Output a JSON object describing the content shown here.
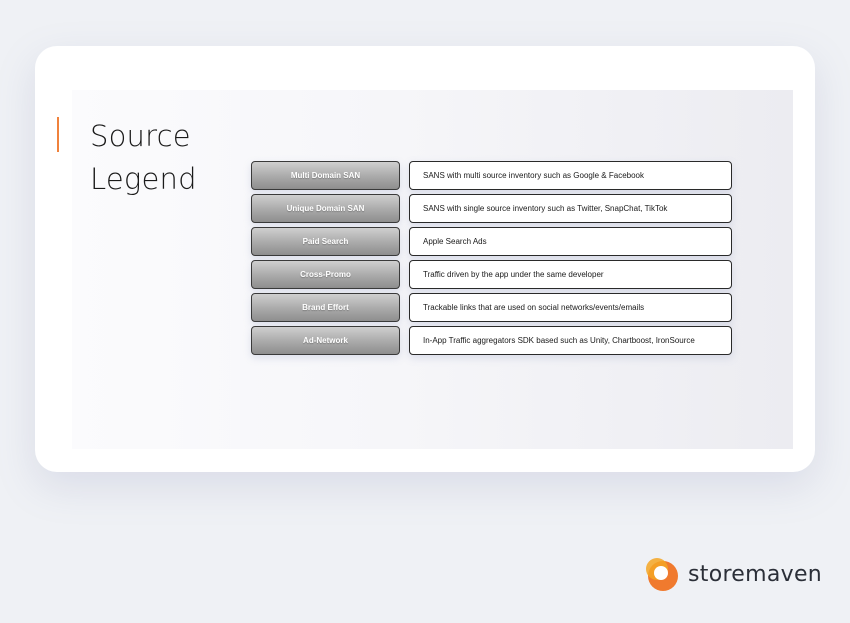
{
  "title": {
    "line1": "Source",
    "line2": "Legend"
  },
  "legend": [
    {
      "source": "Multi Domain SAN",
      "description": "SANS with multi source inventory such as Google & Facebook"
    },
    {
      "source": "Unique Domain SAN",
      "description": "SANS with single source inventory such as Twitter, SnapChat, TikTok"
    },
    {
      "source": "Paid Search",
      "description": "Apple Search Ads"
    },
    {
      "source": "Cross-Promo",
      "description": "Traffic driven by the app under the same developer"
    },
    {
      "source": "Brand Effort",
      "description": "Trackable links that are used on social networks/events/emails"
    },
    {
      "source": "Ad-Network",
      "description": "In-App Traffic aggregators SDK based such as Unity, Chartboost, IronSource"
    }
  ],
  "brand": {
    "name": "storemaven",
    "icon": "storemaven-logo-icon"
  },
  "colors": {
    "accent": "#f0823c",
    "background": "#eff1f5"
  }
}
